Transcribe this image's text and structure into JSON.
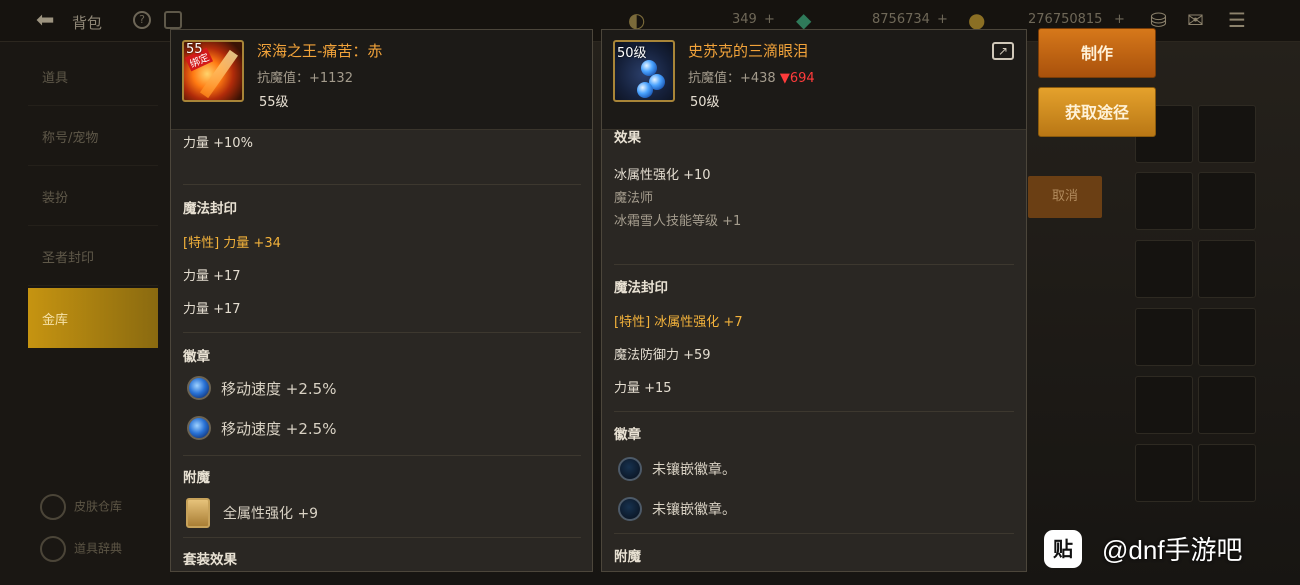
{
  "topbar": {
    "title": "背包",
    "currency_1": "349",
    "currency_2": "8756734",
    "currency_3": "276750815",
    "plus": "+"
  },
  "sidebar": {
    "items": [
      {
        "label": "道具"
      },
      {
        "label": "称号/宠物"
      },
      {
        "label": "装扮"
      },
      {
        "label": "圣者封印"
      },
      {
        "label": "金库"
      }
    ],
    "bottom": [
      {
        "label": "皮肤仓库"
      },
      {
        "label": "道具辞典"
      }
    ],
    "cancel_label": "取消"
  },
  "left_item": {
    "icon_level": "55",
    "icon_tag": "绑定",
    "name": "深海之王-痛苦：赤",
    "resist_label": "抗魔值：+1132",
    "level": "55级",
    "top_stat": "力量 +10%",
    "seal_title": "魔法封印",
    "seal_special_tag": "[特性]",
    "seal_special_value": " 力量 +34",
    "seal_1": "力量 +17",
    "seal_2": "力量 +17",
    "emblem_title": "徽章",
    "emblem_1": "移动速度 +2.5%",
    "emblem_2": "移动速度 +2.5%",
    "enchant_title": "附魔",
    "enchant_1": "全属性强化 +9",
    "set_title": "套装效果"
  },
  "right_item": {
    "icon_level": "50级",
    "name": "史苏克的三滴眼泪",
    "resist_label": "抗魔值：+438 ",
    "resist_diff": "▼694",
    "level": "50级",
    "effect_title": "效果",
    "effect_1": "冰属性强化 +10",
    "effect_class": "魔法师",
    "effect_skill": "冰霜雪人技能等级 +1",
    "seal_title": "魔法封印",
    "seal_special_tag": "[特性]",
    "seal_special_value": " 冰属性强化 +7",
    "seal_1": "魔法防御力 +59",
    "seal_2": "力量 +15",
    "emblem_title": "徽章",
    "emblem_1": "未镶嵌徽章。",
    "emblem_2": "未镶嵌徽章。",
    "enchant_title": "附魔"
  },
  "actions": {
    "make_label": "制作",
    "source_label": "获取途径"
  },
  "watermark": {
    "logo": "贴",
    "text": "@dnf手游吧"
  },
  "colors": {
    "item_name": "#f2a33a",
    "resist_down": "#ff3b3b",
    "button_make": "#c5661a",
    "button_source": "#d08e22",
    "sidebar_active": "#c69411"
  }
}
